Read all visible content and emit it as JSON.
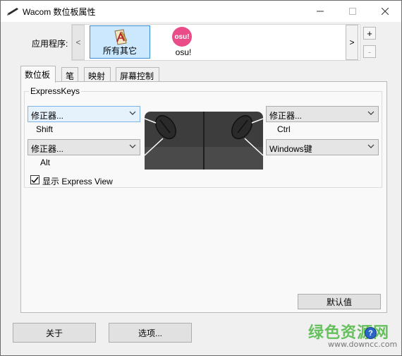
{
  "window": {
    "title": "Wacom 数位板属性"
  },
  "applications": {
    "label": "应用程序:",
    "items": [
      {
        "label": "所有其它",
        "icon": "all-other-apps-icon",
        "selected": true
      },
      {
        "label": "osu!",
        "icon_text": "osu!",
        "icon": "osu-icon",
        "selected": false
      }
    ],
    "scroll_left": "<",
    "scroll_right": ">",
    "add_label": "+",
    "remove_label": "-"
  },
  "tabs": [
    {
      "label": "数位板",
      "active": true
    },
    {
      "label": "笔",
      "active": false
    },
    {
      "label": "映射",
      "active": false
    },
    {
      "label": "屏幕控制",
      "active": false
    }
  ],
  "expresskeys": {
    "group_label": "ExpressKeys",
    "left_top": {
      "value": "修正器...",
      "key": "Shift"
    },
    "left_bottom": {
      "value": "修正器...",
      "key": "Alt"
    },
    "right_top": {
      "value": "修正器...",
      "key": "Ctrl"
    },
    "right_bottom": {
      "value": "Windows键"
    },
    "show_express_view": {
      "label": "显示 Express View",
      "checked": true
    }
  },
  "buttons": {
    "default": "默认值",
    "about": "关于",
    "options": "选项..."
  },
  "watermark": {
    "title": "绿色资源网",
    "url": "www.downcc.com"
  },
  "colors": {
    "selection_bg": "#cce8ff",
    "selection_border": "#3c8dd9",
    "osu_pink": "#ea4c89",
    "watermark_green": "#4fb845"
  }
}
